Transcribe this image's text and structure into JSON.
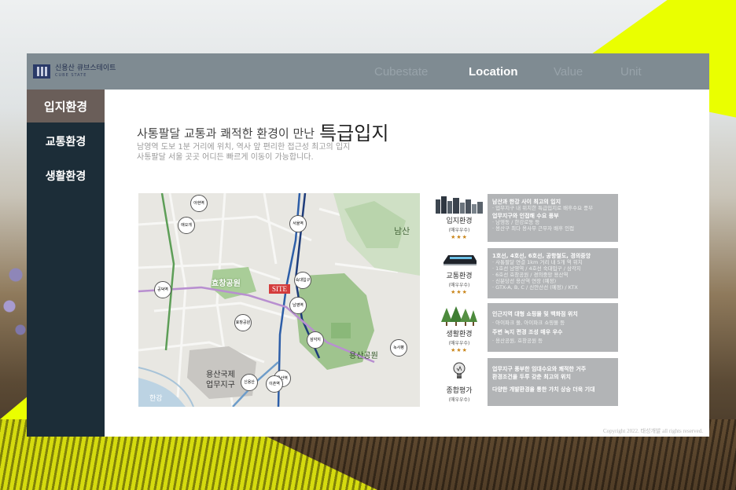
{
  "brand": {
    "name": "신용산 큐브스테이트",
    "sub": "CUBE STATE"
  },
  "nav": [
    {
      "label": "Cubestate",
      "active": false
    },
    {
      "label": "Location",
      "active": true
    },
    {
      "label": "Value",
      "active": false
    },
    {
      "label": "Unit",
      "active": false
    }
  ],
  "sidebar": {
    "items": [
      {
        "label": "입지환경",
        "active": true
      },
      {
        "label": "교통환경",
        "active": false
      },
      {
        "label": "생활환경",
        "active": false
      }
    ]
  },
  "main": {
    "heading": "사통팔달 교통과 쾌적한 환경이 만난",
    "heading_emphasis": "특급입지",
    "desc_line1": "남영역 도보 1분 거리에 위치, 역사 앞 편리한 접근성 최고의 입지",
    "desc_line2": "사통팔달 서울 곳곳 어디든 빠르게 이동이 가능합니다."
  },
  "map": {
    "site_label": "SITE",
    "labels": {
      "namsan": "남산",
      "hyochang_park": "효창공원",
      "yongsan_park": "용산공원",
      "intl_district_1": "용산국제",
      "intl_district_2": "업무지구",
      "hangang": "한강"
    },
    "stations": [
      "서울역",
      "숙대입구",
      "남영역",
      "용산역",
      "삼각지",
      "녹사평",
      "신용산",
      "이촌역",
      "효창공원",
      "공덕역",
      "애오개",
      "아현역"
    ]
  },
  "categories": [
    {
      "name": "입지환경",
      "sub": "(매우우수)",
      "stars": "★★★",
      "icon": "city-skyline-icon",
      "lines": [
        {
          "t": "남산과 한강 사이 최고의 입지",
          "s": "strong"
        },
        {
          "t": "· 업무지구 내 위치한 특급입지로 배후수요 풍부",
          "s": "faint"
        },
        {
          "t": "업무지구와 인접해 수요 풍부",
          "s": "strong"
        },
        {
          "t": "· 남영동 / 한강로동 등",
          "s": "faint"
        },
        {
          "t": "· 용산구 최다 용사무 근무자 배후 인접",
          "s": "faint"
        }
      ]
    },
    {
      "name": "교통환경",
      "sub": "(매우우수)",
      "stars": "★★★",
      "icon": "train-icon",
      "lines": [
        {
          "t": "1호선, 4호선, 6호선, 공항철도, 경의중앙",
          "s": "strong"
        },
        {
          "t": "· 사통팔달 연결 1km 거리 내 5개 역 위치",
          "s": "faint"
        },
        {
          "t": "· 1호선 남영역 / 4호선 숙대입구 / 삼각지",
          "s": "faint"
        },
        {
          "t": "· 6호선 효창공원 / 경의중앙 용산역",
          "s": "faint"
        },
        {
          "t": "· 신분당선 용산역 연장 (예정)",
          "s": "faint"
        },
        {
          "t": "· GTX-A, B, C / 신안산선 (예정) / KTX",
          "s": "faint"
        }
      ]
    },
    {
      "name": "생활환경",
      "sub": "(매우우수)",
      "stars": "★★★",
      "icon": "trees-icon",
      "lines": [
        {
          "t": "인근지역 대형 쇼핑몰 및 백화점 위치",
          "s": "strong"
        },
        {
          "t": "· 아이파크 몰, 아이파크 쇼핑몰 등",
          "s": "faint"
        },
        {
          "t": "주변 녹지 편경 조성 매우 우수",
          "s": "strong"
        },
        {
          "t": "· 용산공원, 효창공원 등",
          "s": "faint"
        }
      ]
    },
    {
      "name": "종합평가",
      "sub": "(매우우수)",
      "stars": "",
      "icon": "lightbulb-icon",
      "lines": [
        {
          "t": "업무지구 풍부한 임대수요와 쾌적한 거주",
          "s": "strong"
        },
        {
          "t": "환경조건을 두루 갖춘 최고의 위치",
          "s": "strong"
        },
        {
          "t": "다양한 개발환경을 통한 가치 상승 더욱 기대",
          "s": "strong"
        }
      ]
    }
  ],
  "copyright": "Copyright 2022. 태성개발 all rights reserved.",
  "colors": {
    "accent_yellow": "#eaff00",
    "topbar": "#7f8b92",
    "sidebar": "#1c2d38",
    "sidebar_active": "#6a5e59",
    "info_box": "#b2b4b6",
    "site_marker": "#d43c3c",
    "park_green": "#9fc48e"
  }
}
